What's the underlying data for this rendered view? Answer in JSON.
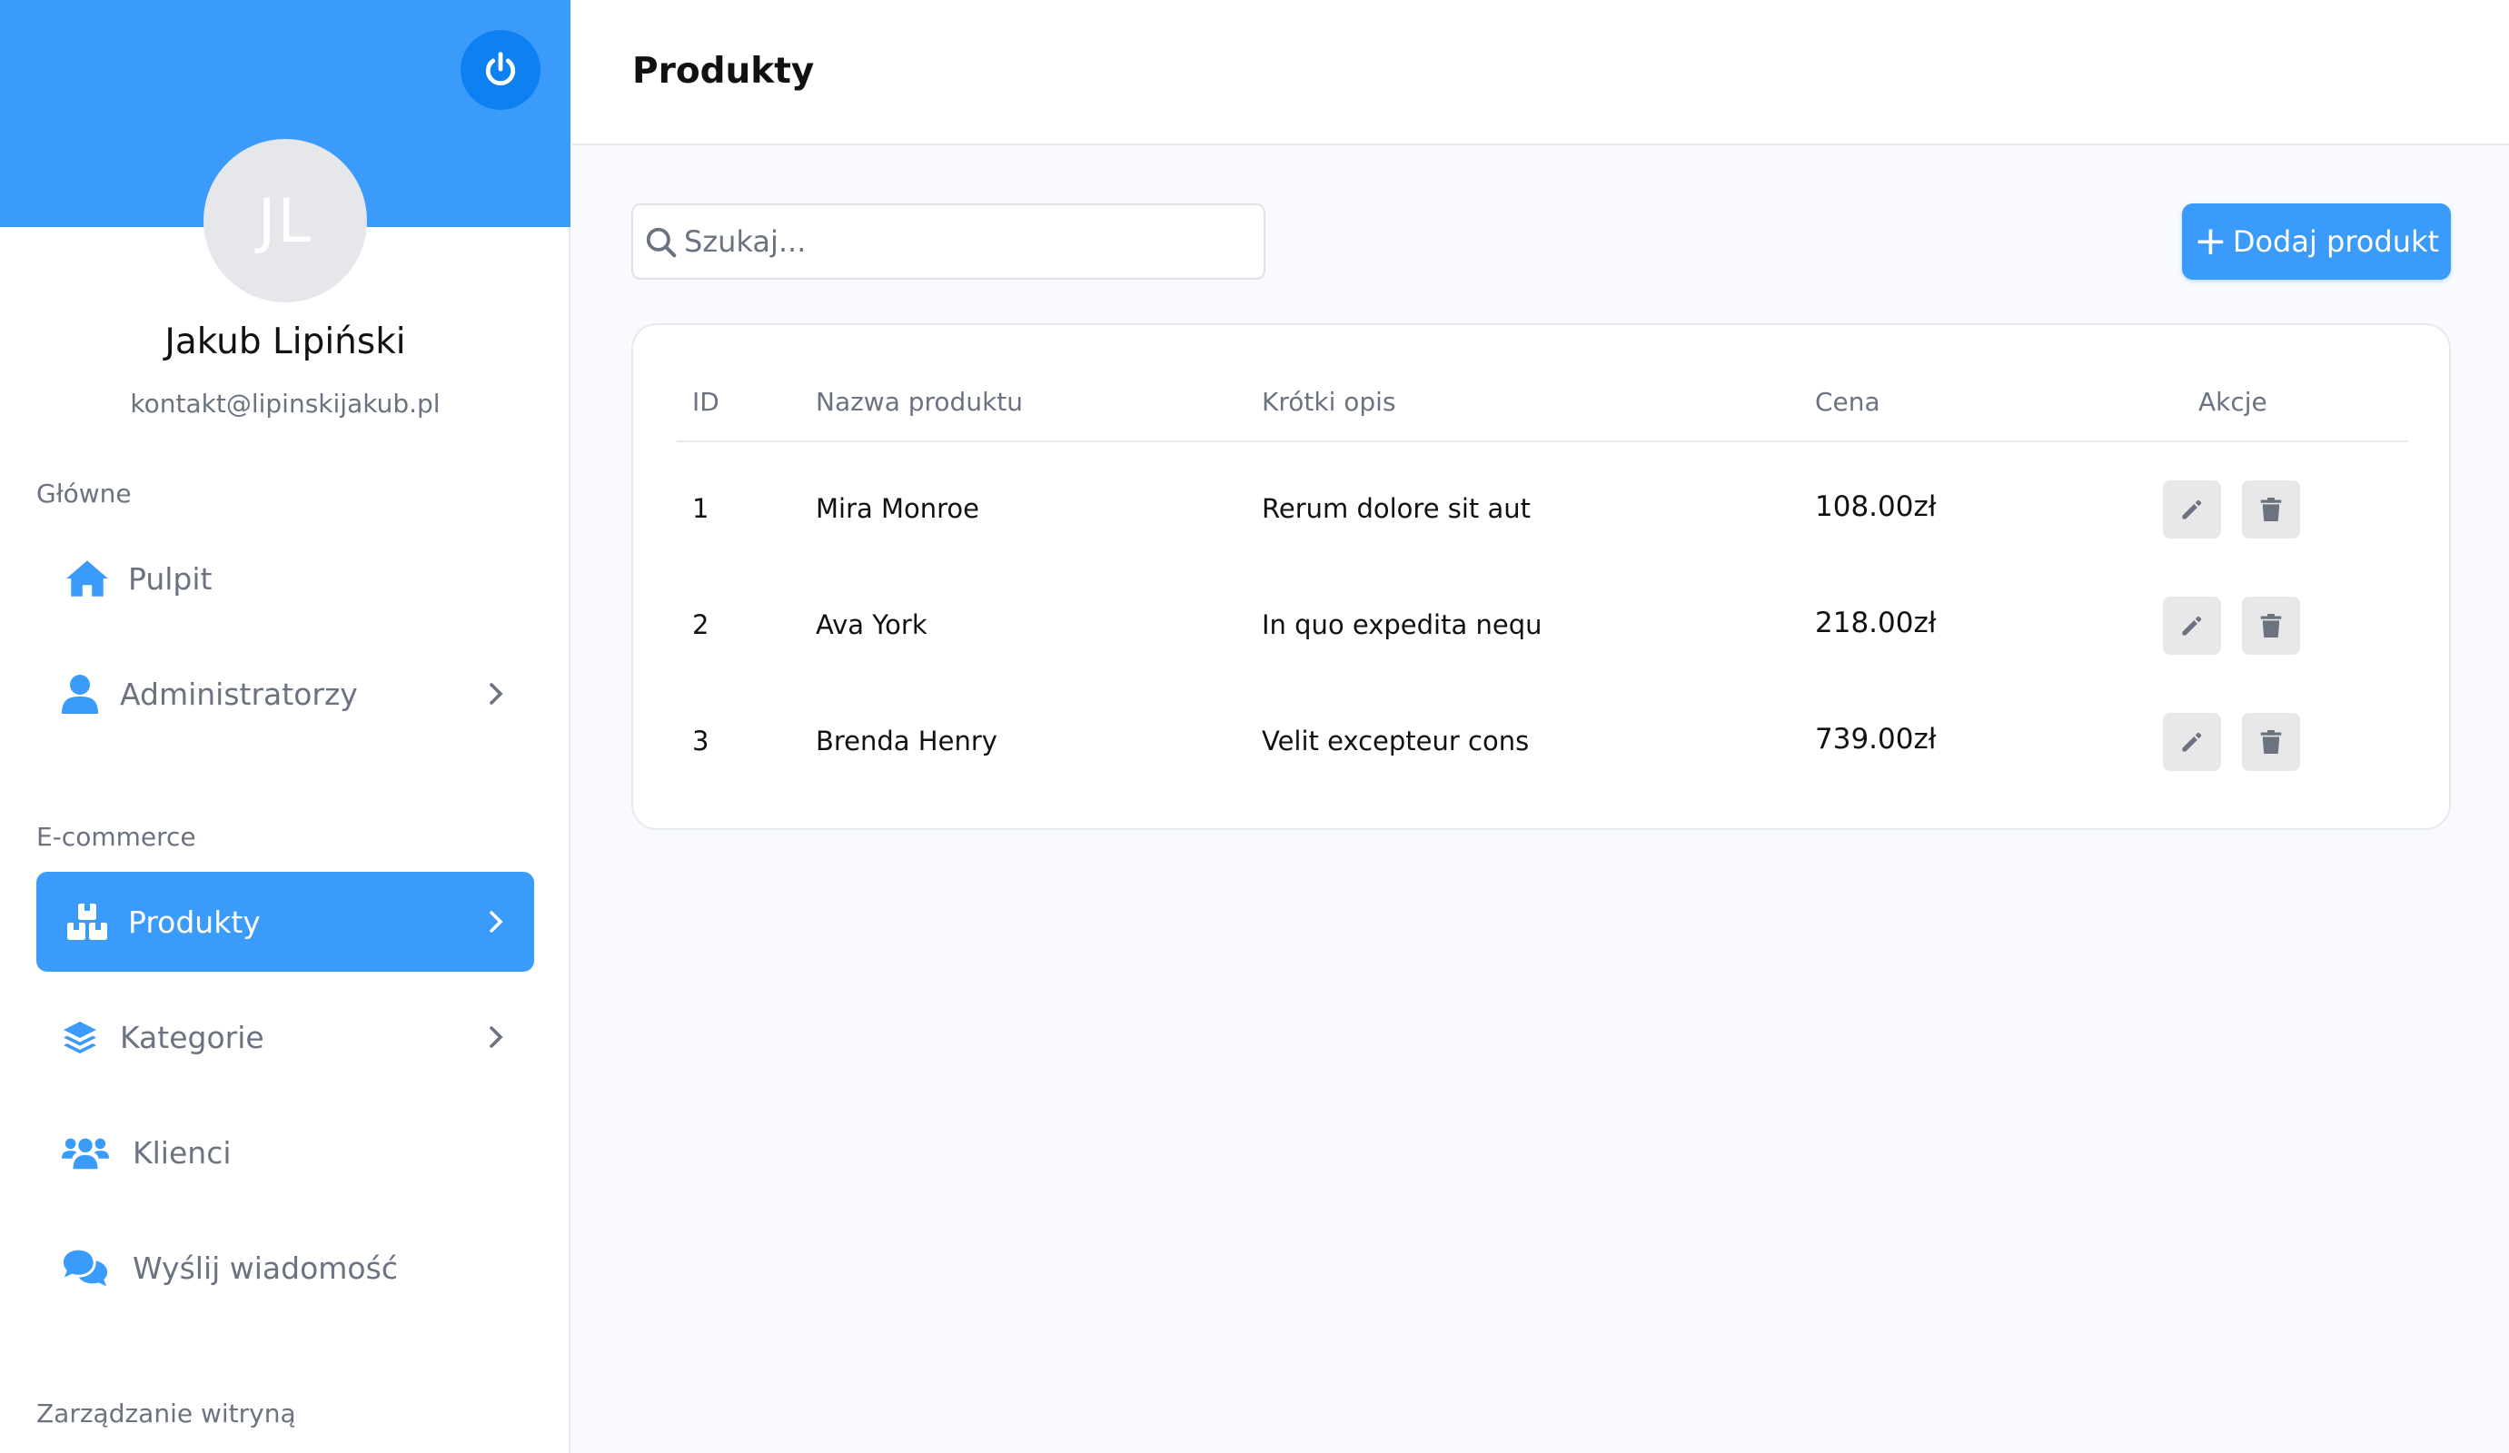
{
  "sidebar": {
    "avatar_initials": "JL",
    "user_name": "Jakub Lipiński",
    "user_email": "kontakt@lipinskijakub.pl",
    "sections": {
      "main": "Główne",
      "ecommerce": "E-commerce",
      "site": "Zarządzanie witryną"
    },
    "items": {
      "pulpit": "Pulpit",
      "admins": "Administratorzy",
      "products": "Produkty",
      "categories": "Kategorie",
      "clients": "Klienci",
      "message": "Wyślij wiadomość"
    }
  },
  "header": {
    "title": "Produkty"
  },
  "toolbar": {
    "search_placeholder": "Szukaj...",
    "add_label": "Dodaj produkt"
  },
  "table": {
    "headers": {
      "id": "ID",
      "name": "Nazwa produktu",
      "desc": "Krótki opis",
      "price": "Cena",
      "actions": "Akcje"
    },
    "rows": [
      {
        "id": "1",
        "name": "Mira Monroe",
        "desc": "Rerum dolore sit aut",
        "price": "108.00zł"
      },
      {
        "id": "2",
        "name": "Ava York",
        "desc": "In quo expedita nequ",
        "price": "218.00zł"
      },
      {
        "id": "3",
        "name": "Brenda Henry",
        "desc": "Velit excepteur cons",
        "price": "739.00zł"
      }
    ]
  },
  "colors": {
    "accent": "#3b9bfa",
    "accent_dark": "#0d80f2",
    "muted": "#6b7280"
  }
}
